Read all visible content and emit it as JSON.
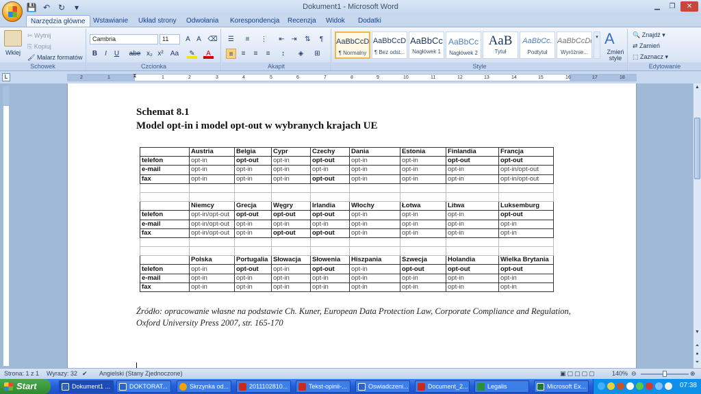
{
  "window": {
    "title": "Dokument1 - Microsoft Word"
  },
  "qat": {
    "save": "💾",
    "undo": "↶",
    "redo": "↻",
    "more": "▾"
  },
  "tabs": [
    "Narzędzia główne",
    "Wstawianie",
    "Układ strony",
    "Odwołania",
    "Korespondencja",
    "Recenzja",
    "Widok",
    "Dodatki"
  ],
  "ribbon": {
    "clipboard": {
      "paste": "Wklej",
      "cut": "Wytnij",
      "copy": "Kopiuj",
      "format_painter": "Malarz formatów",
      "label": "Schowek"
    },
    "font": {
      "name": "Cambria",
      "size": "11",
      "label": "Czcionka",
      "bold": "B",
      "italic": "I",
      "underline": "U",
      "strike": "abe",
      "sub": "x₂",
      "sup": "x²",
      "case": "Aa"
    },
    "paragraph": {
      "label": "Akapit"
    },
    "styles": {
      "label": "Style",
      "items": [
        {
          "sample": "AaBbCcD",
          "name": "¶ Normalny"
        },
        {
          "sample": "AaBbCcD",
          "name": "¶ Bez odst..."
        },
        {
          "sample": "AaBbCc",
          "name": "Nagłówek 1"
        },
        {
          "sample": "AaBbCc",
          "name": "Nagłówek 2"
        },
        {
          "sample": "AaB",
          "name": "Tytuł"
        },
        {
          "sample": "AaBbCc.",
          "name": "Podtytuł"
        },
        {
          "sample": "AaBbCcDc",
          "name": "Wyróżnie..."
        }
      ],
      "change": "Zmień style"
    },
    "editing": {
      "find": "Znajdź",
      "replace": "Zamień",
      "select": "Zaznacz",
      "label": "Edytowanie"
    }
  },
  "ruler_ticks": [
    "2",
    "1",
    "1",
    "2",
    "3",
    "4",
    "5",
    "6",
    "7",
    "8",
    "9",
    "10",
    "11",
    "12",
    "13",
    "14",
    "15",
    "16",
    "17",
    "18"
  ],
  "document": {
    "heading1": "Schemat 8.1",
    "heading2": "Model opt-in i model opt-out w wybranych krajach UE",
    "source": "Źródło: opracowanie własne na podstawie Ch. Kuner, European Data Protection Law, Corporate Compliance and Regulation, Oxford University Press 2007, str. 165-170",
    "table": {
      "blocks": [
        {
          "countries": [
            "Austria",
            "Belgia",
            "Cypr",
            "Czechy",
            "Dania",
            "Estonia",
            "Finlandia",
            "Francja"
          ],
          "rows": [
            {
              "label": "telefon",
              "values": [
                "opt-in",
                "opt-out",
                "opt-in",
                "opt-out",
                "opt-in",
                "opt-in",
                "opt-out",
                "opt-out"
              ]
            },
            {
              "label": "e-mail",
              "values": [
                "opt-in",
                "opt-in",
                "opt-in",
                "opt-in",
                "opt-in",
                "opt-in",
                "opt-in",
                "opt-in/opt-out"
              ]
            },
            {
              "label": "fax",
              "values": [
                "opt-in",
                "opt-in",
                "opt-in",
                "opt-out",
                "opt-in",
                "opt-in",
                "opt-in",
                "opt-in/opt-out"
              ]
            }
          ]
        },
        {
          "countries": [
            "Niemcy",
            "Grecja",
            "Węgry",
            "Irlandia",
            "Włochy",
            "Łotwa",
            "Litwa",
            "Luksemburg"
          ],
          "rows": [
            {
              "label": "telefon",
              "values": [
                "opt-in/opt-out",
                "opt-out",
                "opt-out",
                "opt-out",
                "opt-in",
                "opt-in",
                "opt-in",
                "opt-out"
              ]
            },
            {
              "label": "e-mail",
              "values": [
                "opt-in/opt-out",
                "opt-in",
                "opt-in",
                "opt-in",
                "opt-in",
                "opt-in",
                "opt-in",
                "opt-in"
              ]
            },
            {
              "label": "fax",
              "values": [
                "opt-in/opt-out",
                "opt-in",
                "opt-out",
                "opt-out",
                "opt-in",
                "opt-in",
                "opt-in",
                "opt-in"
              ]
            }
          ]
        },
        {
          "countries": [
            "Polska",
            "Portugalia",
            "Słowacja",
            "Słowenia",
            "Hiszpania",
            "Szwecja",
            "Holandia",
            "Wielka Brytania"
          ],
          "rows": [
            {
              "label": "telefon",
              "values": [
                "opt-in",
                "opt-out",
                "opt-in",
                "opt-out",
                "opt-in",
                "opt-out",
                "opt-out",
                "opt-out"
              ]
            },
            {
              "label": "e-mail",
              "values": [
                "opt-in",
                "opt-in",
                "opt-in",
                "opt-in",
                "opt-in",
                "opt-in",
                "opt-in",
                "opt-in"
              ]
            },
            {
              "label": "fax",
              "values": [
                "opt-in",
                "opt-in",
                "opt-in",
                "opt-in",
                "opt-in",
                "opt-in",
                "opt-in",
                "opt-in"
              ]
            }
          ]
        }
      ]
    }
  },
  "status": {
    "page": "Strona: 1 z 1",
    "words": "Wyrazy: 32",
    "language": "Angielski (Stany Zjednoczone)",
    "zoom": "140%"
  },
  "taskbar": {
    "start": "Start",
    "tasks": [
      "Dokument1 ...",
      "DOKTORAT...",
      "Skrzynka od...",
      "2011102810...",
      "Tekst-opinii-...",
      "Oswiadczeni...",
      "Document_2...",
      "Legalis",
      "Microsoft Ex..."
    ],
    "clock": "07:38"
  }
}
